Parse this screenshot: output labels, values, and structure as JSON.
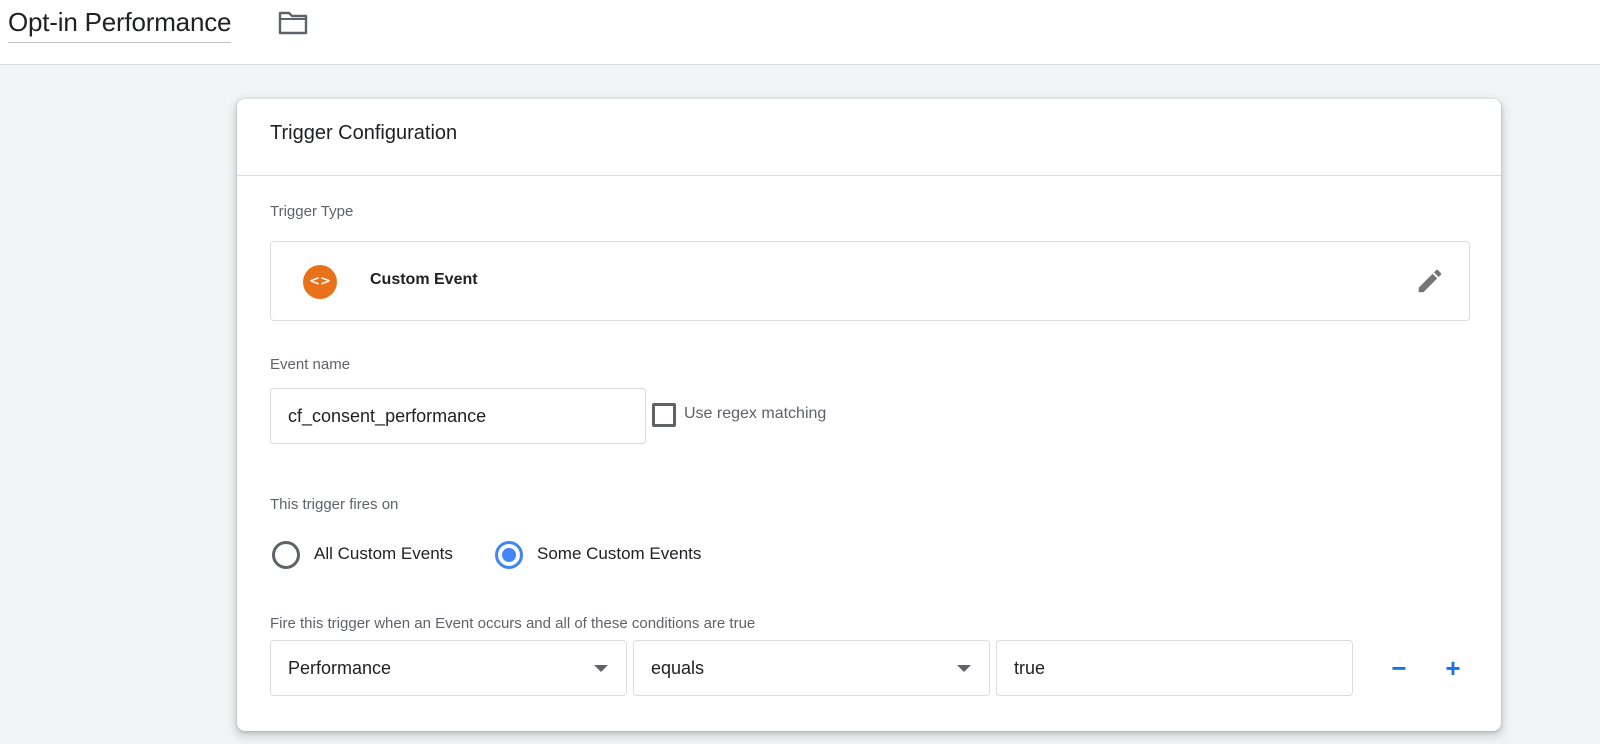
{
  "header": {
    "title": "Opt-in Performance",
    "folder_icon": "folder-icon"
  },
  "card": {
    "title": "Trigger Configuration",
    "trigger_type_label": "Trigger Type",
    "trigger_type": {
      "name": "Custom Event",
      "icon": "code-brackets-icon",
      "icon_glyph": "<>",
      "icon_color": "#e8711a",
      "edit_icon": "pencil-icon"
    },
    "event_name_label": "Event name",
    "event_name_value": "cf_consent_performance",
    "regex_checkbox": {
      "label": "Use regex matching",
      "checked": false
    },
    "fires_on_label": "This trigger fires on",
    "fires_on_options": [
      {
        "label": "All Custom Events",
        "selected": false
      },
      {
        "label": "Some Custom Events",
        "selected": true
      }
    ],
    "condition_label": "Fire this trigger when an Event occurs and all of these conditions are true",
    "condition": {
      "variable": "Performance",
      "operator": "equals",
      "value": "true",
      "remove_label": "−",
      "add_label": "+"
    }
  },
  "colors": {
    "accent": "#4285f4",
    "link": "#1a73e8",
    "trigger_icon": "#e8711a",
    "background": "#f1f3f4"
  }
}
